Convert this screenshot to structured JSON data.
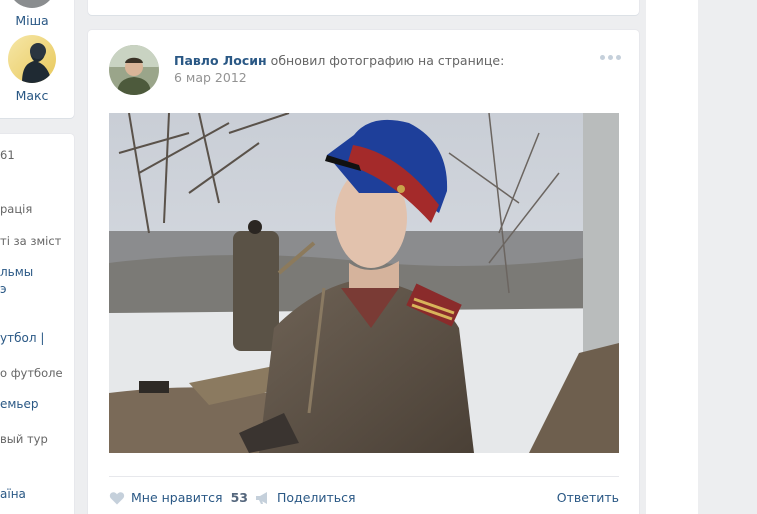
{
  "friends": [
    {
      "name": "Міша"
    },
    {
      "name": "Макс"
    }
  ],
  "groups": {
    "items": [
      {
        "text": "61",
        "sub": true
      },
      {
        "text": "рація",
        "sub": true
      },
      {
        "text": "ті за зміст",
        "sub": true
      },
      {
        "text": "льмы",
        "sub": false
      },
      {
        "text": "э",
        "sub": false
      },
      {
        "text": "утбол |",
        "sub": false
      },
      {
        "text": "о футболе",
        "sub": true
      },
      {
        "text": "емьер",
        "sub": false
      },
      {
        "text": "вый тур",
        "sub": true
      },
      {
        "text": "аїна",
        "sub": false
      }
    ]
  },
  "post": {
    "author_name": "Павло Лосин",
    "action_text": "обновил фотографию на странице:",
    "date": "6 мар 2012",
    "more_icon": "more-horizontal-icon",
    "photo_alt": "photo",
    "actions": {
      "like_label": "Мне нравится",
      "like_count": "53",
      "share_label": "Поделиться",
      "reply_label": "Ответить"
    }
  },
  "colors": {
    "link": "#2a5885",
    "muted": "#939393",
    "bg": "#edeef0"
  }
}
